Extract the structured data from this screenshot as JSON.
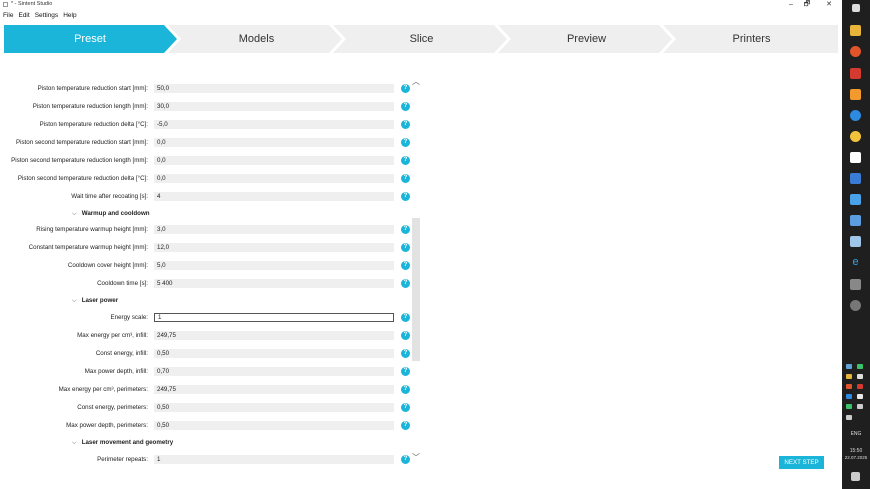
{
  "window": {
    "title": "* - Sintent Studio",
    "controls": {
      "minimize": "–",
      "maximize": "🗗",
      "close": "✕"
    }
  },
  "menu": [
    "File",
    "Edit",
    "Settings",
    "Help"
  ],
  "steps": [
    "Preset",
    "Models",
    "Slice",
    "Preview",
    "Printers"
  ],
  "active_step": "Preset",
  "accent_color": "#1ab5d8",
  "rows": [
    {
      "type": "field",
      "label": "Piston temperature reduction start [mm]:",
      "value": "50,0"
    },
    {
      "type": "field",
      "label": "Piston temperature reduction length [mm]:",
      "value": "30,0"
    },
    {
      "type": "field",
      "label": "Piston temperature reduction delta [°C]:",
      "value": "-5,0"
    },
    {
      "type": "field",
      "label": "Piston second temperature reduction start [mm]:",
      "value": "0,0"
    },
    {
      "type": "field",
      "label": "Piston second temperature reduction length [mm]:",
      "value": "0,0"
    },
    {
      "type": "field",
      "label": "Piston second temperature reduction delta [°C]:",
      "value": "0,0"
    },
    {
      "type": "field",
      "label": "Wait time after recoating [s]:",
      "value": "4"
    },
    {
      "type": "section",
      "label": "Warmup and cooldown"
    },
    {
      "type": "field",
      "label": "Rising temperature warmup height [mm]:",
      "value": "3,0"
    },
    {
      "type": "field",
      "label": "Constant temperature warmup height [mm]:",
      "value": "12,0"
    },
    {
      "type": "field",
      "label": "Cooldown cover height [mm]:",
      "value": "5,0"
    },
    {
      "type": "field",
      "label": "Cooldown time [s]:",
      "value": "5 400"
    },
    {
      "type": "section",
      "label": "Laser power"
    },
    {
      "type": "field",
      "label": "Energy scale:",
      "value": "1",
      "focused": true
    },
    {
      "type": "field",
      "label": "Max energy per cm³, infill:",
      "value": "249,75"
    },
    {
      "type": "field",
      "label": "Const energy, infill:",
      "value": "0,50"
    },
    {
      "type": "field",
      "label": "Max power depth, infill:",
      "value": "0,70"
    },
    {
      "type": "field",
      "label": "Max energy per cm³, perimeters:",
      "value": "249,75"
    },
    {
      "type": "field",
      "label": "Const energy, perimeters:",
      "value": "0,50"
    },
    {
      "type": "field",
      "label": "Max power depth, perimeters:",
      "value": "0,50"
    },
    {
      "type": "section",
      "label": "Laser movement and geometry"
    },
    {
      "type": "field",
      "label": "Perimeter repeats:",
      "value": "1"
    }
  ],
  "help_glyph": "?",
  "next_button": "NEXT STEP",
  "taskbar": {
    "language": "ENG",
    "time": "15:50",
    "date": "22.07.2025"
  }
}
